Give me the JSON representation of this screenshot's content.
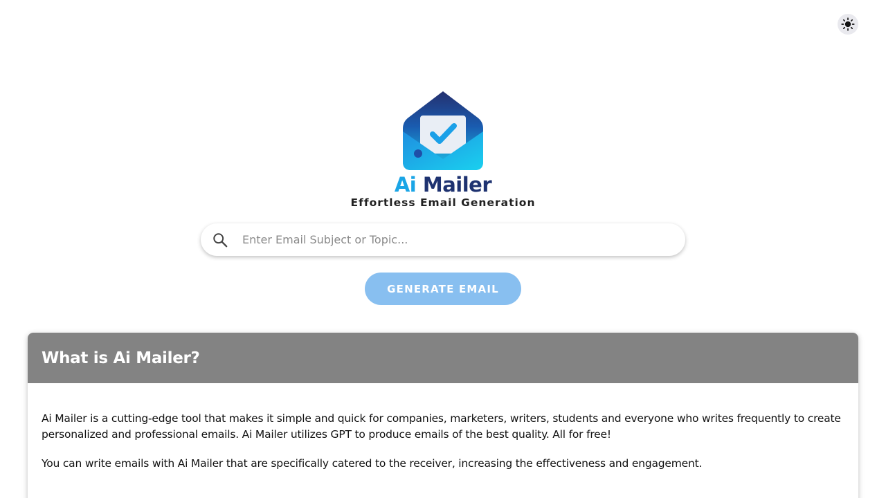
{
  "header": {
    "theme_toggle_icon": "sun-icon"
  },
  "branding": {
    "logo_icon": "envelope-check-icon",
    "name_part1": "Ai",
    "name_part2": "Mailer",
    "tagline": "Effortless Email Generation",
    "colors": {
      "ai_blue": "#1aa5e6",
      "navy": "#1e3270"
    }
  },
  "search": {
    "icon": "search-icon",
    "placeholder": "Enter Email Subject or Topic...",
    "value": ""
  },
  "actions": {
    "generate_label": "GENERATE EMAIL",
    "generate_color": "#88bff0"
  },
  "info_card": {
    "title": "What is Ai Mailer?",
    "header_color": "#838383",
    "paragraphs": [
      "Ai Mailer is a cutting-edge tool that makes it simple and quick for companies, marketers, writers, students and everyone who writes frequently to create personalized and professional emails. Ai Mailer utilizes GPT to produce emails of the best quality. All for free!",
      "You can write emails with Ai Mailer that are specifically catered to the receiver, increasing the effectiveness and engagement."
    ]
  }
}
